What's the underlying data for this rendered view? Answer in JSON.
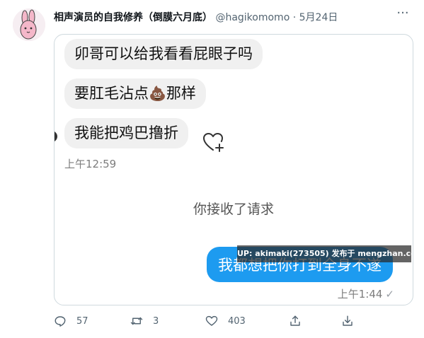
{
  "tweet": {
    "author_name": "相声演员的自我修养（倒膜六月底）",
    "author_handle": "@hagikomomo",
    "separator": "·",
    "date": "5月24日",
    "more_label": "···"
  },
  "chat": {
    "messages_left": [
      "卯哥可以给我看看屁眼子吗",
      "要肛毛沾点",
      "那样",
      "我能把鸡巴撸折"
    ],
    "poo_emoji": "💩",
    "time_left": "上午12:59",
    "system_message": "你接收了请求",
    "message_right": "我都想把你打到全身不遂",
    "time_right": "上午1:44",
    "read_check": "✓",
    "watermark": "UP: akimaki(273505) 发布于 mengzhan.cc"
  },
  "actions": {
    "reply_count": "57",
    "retweet_count": "3",
    "like_count": "403"
  },
  "colors": {
    "accent": "#1d9bf0",
    "bubble_gray": "#f0f0f0",
    "text_secondary": "#536471"
  }
}
